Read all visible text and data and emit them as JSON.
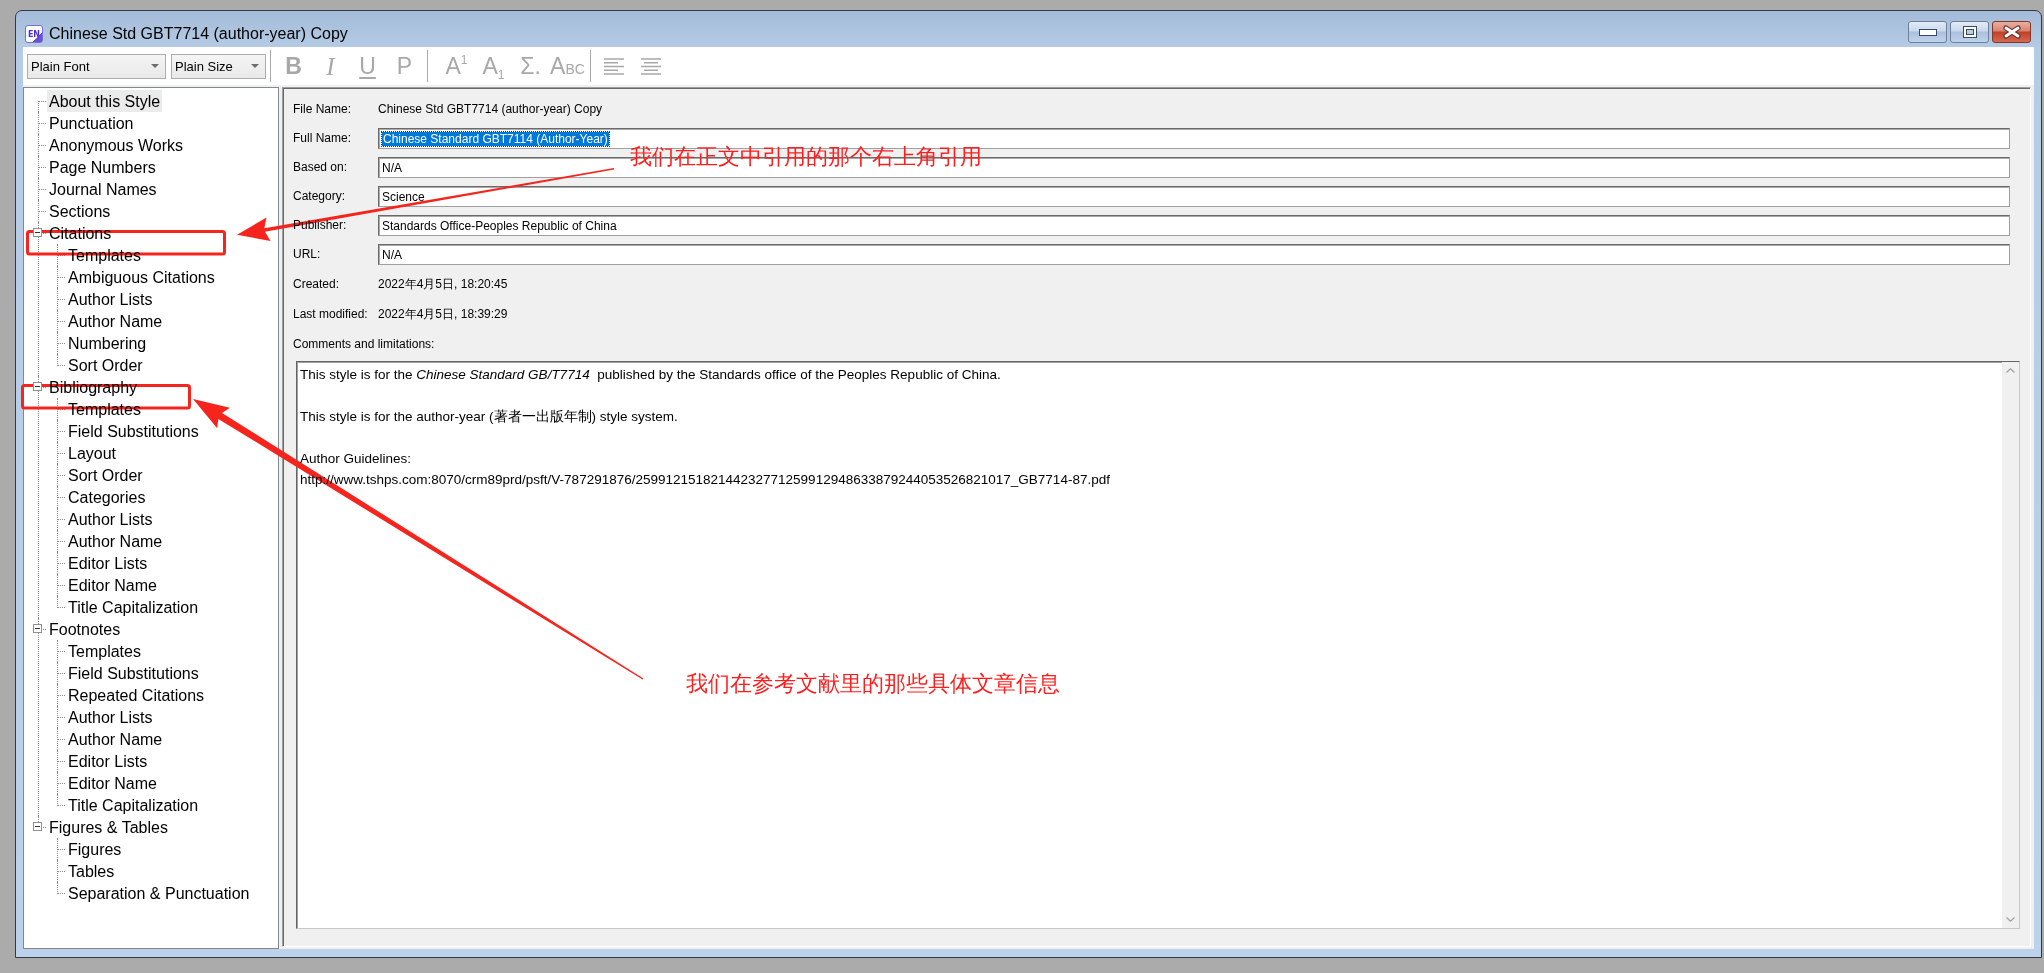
{
  "window": {
    "title": "Chinese Std GBT7714 (author-year) Copy",
    "app_icon_text": "EN"
  },
  "toolbar": {
    "dropdowns": [
      {
        "kind": "font",
        "value": "Plain Font"
      },
      {
        "kind": "size",
        "value": "Plain Size"
      }
    ],
    "groups": [
      {
        "buttons": [
          {
            "kind": "bold",
            "label": "B",
            "disabled": true
          },
          {
            "kind": "italic",
            "label": "I",
            "disabled": true
          },
          {
            "kind": "underline",
            "label": "U",
            "disabled": true
          },
          {
            "kind": "plain",
            "label": "P",
            "disabled": true
          }
        ]
      },
      {
        "buttons": [
          {
            "kind": "superscript",
            "label": "A$^{1}$",
            "disabled": true
          },
          {
            "kind": "subscript",
            "label": "A$_{1}$",
            "disabled": true
          },
          {
            "kind": "symbol",
            "label": "Σ.",
            "disabled": true
          },
          {
            "kind": "small_caps",
            "label": "ABC",
            "disabled": true
          }
        ]
      },
      {
        "buttons": [
          {
            "kind": "align_left",
            "disabled": true
          },
          {
            "kind": "align_center",
            "disabled": true
          }
        ]
      }
    ]
  },
  "sidebar": {
    "tree": [
      {
        "label": "About this Style",
        "selected": true
      },
      {
        "label": "Punctuation",
        "selected": false
      },
      {
        "label": "Anonymous Works",
        "selected": false
      },
      {
        "label": "Page Numbers",
        "selected": false
      },
      {
        "label": "Journal Names",
        "selected": false
      },
      {
        "label": "Sections",
        "selected": false
      },
      {
        "label": "Citations",
        "selected": false,
        "expanded": true,
        "children": [
          {
            "label": "Templates",
            "selected": false
          },
          {
            "label": "Ambiguous Citations",
            "selected": false
          },
          {
            "label": "Author Lists",
            "selected": false
          },
          {
            "label": "Author Name",
            "selected": false
          },
          {
            "label": "Numbering",
            "selected": false
          },
          {
            "label": "Sort Order",
            "selected": false
          }
        ]
      },
      {
        "label": "Bibliography",
        "selected": false,
        "expanded": true,
        "children": [
          {
            "label": "Templates",
            "selected": false
          },
          {
            "label": "Field Substitutions",
            "selected": false
          },
          {
            "label": "Layout",
            "selected": false
          },
          {
            "label": "Sort Order",
            "selected": false
          },
          {
            "label": "Categories",
            "selected": false
          },
          {
            "label": "Author Lists",
            "selected": false
          },
          {
            "label": "Author Name",
            "selected": false
          },
          {
            "label": "Editor Lists",
            "selected": false
          },
          {
            "label": "Editor Name",
            "selected": false
          },
          {
            "label": "Title Capitalization",
            "selected": false
          }
        ]
      },
      {
        "label": "Footnotes",
        "selected": false,
        "expanded": true,
        "children": [
          {
            "label": "Templates",
            "selected": false
          },
          {
            "label": "Field Substitutions",
            "selected": false
          },
          {
            "label": "Repeated Citations",
            "selected": false
          },
          {
            "label": "Author Lists",
            "selected": false
          },
          {
            "label": "Author Name",
            "selected": false
          },
          {
            "label": "Editor Lists",
            "selected": false
          },
          {
            "label": "Editor Name",
            "selected": false
          },
          {
            "label": "Title Capitalization",
            "selected": false
          }
        ]
      },
      {
        "label": "Figures & Tables",
        "selected": false,
        "expanded": true,
        "children": [
          {
            "label": "Figures",
            "selected": false
          },
          {
            "label": "Tables",
            "selected": false
          },
          {
            "label": "Separation & Punctuation",
            "selected": false
          }
        ]
      }
    ]
  },
  "details": {
    "fields": [
      {
        "kind": "static",
        "label": "File Name:",
        "value": "Chinese Std GBT7714 (author-year) Copy"
      },
      {
        "kind": "input",
        "label": "Full Name:",
        "value": "Chinese Standard GBT7114 (Author-Year)",
        "text_selected": true
      },
      {
        "kind": "input",
        "label": "Based on:",
        "value": "N/A",
        "text_selected": false
      },
      {
        "kind": "input",
        "label": "Category:",
        "value": "Science",
        "text_selected": false
      },
      {
        "kind": "input",
        "label": "Publisher:",
        "value": "Standards Office-Peoples Republic of China",
        "text_selected": false
      },
      {
        "kind": "input",
        "label": "URL:",
        "value": "N/A",
        "text_selected": false
      },
      {
        "kind": "static",
        "label": "Created:",
        "value": "2022年4月5日, 18:20:45"
      },
      {
        "kind": "static",
        "label": "Last modified:",
        "value": "2022年4月5日, 18:39:29"
      }
    ],
    "comments": {
      "label": "Comments and limitations:",
      "paragraphs": [
        {
          "lines": [
            "This style is for the *Chinese Standard GB/T7714*  published by the Standards office of the Peoples Republic of China."
          ]
        },
        {
          "lines": [
            "This style is for the author-year (著者一出版年制) style system."
          ]
        },
        {
          "lines": [
            "Author Guidelines:",
            "http://www.tshps.com:8070/crm89prd/psft/V-787291876/25991215182144232771259912948633879244053526821017_GB7714-87.pdf"
          ]
        }
      ]
    }
  },
  "annotations": [
    {
      "kind": "callout",
      "text": "我们在正文中引用的那个右上角引用"
    },
    {
      "kind": "callout",
      "text": "我们在参考文献里的那些具体文章信息"
    }
  ]
}
